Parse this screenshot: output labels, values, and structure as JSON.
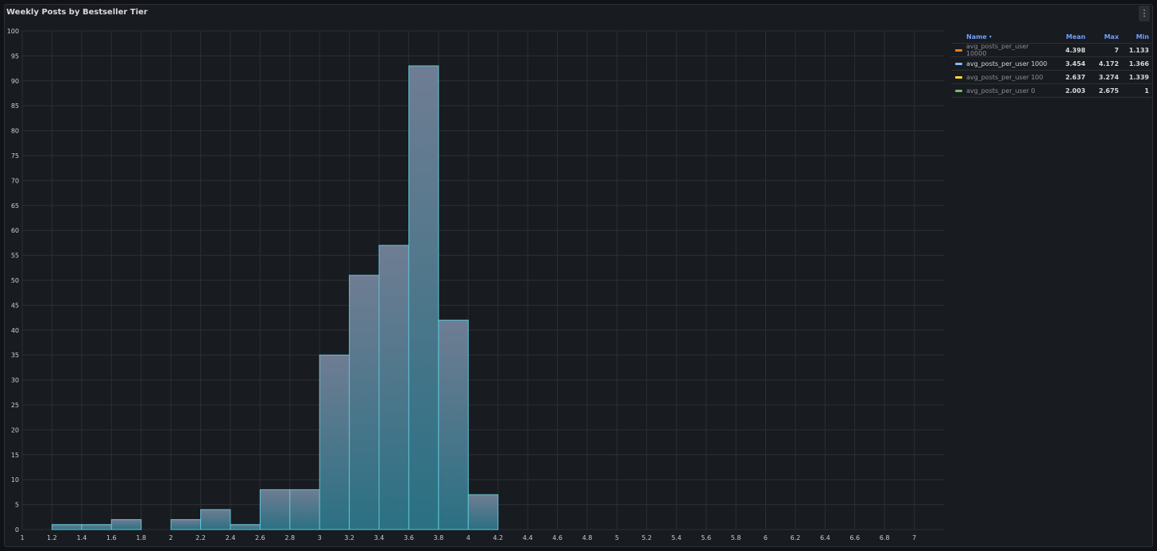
{
  "panel": {
    "title": "Weekly Posts by Bestseller Tier",
    "menu_icon": "kebab-menu-icon"
  },
  "legend": {
    "headers": {
      "name": "Name",
      "mean": "Mean",
      "max": "Max",
      "min": "Min"
    },
    "sort_indicator": "sort-desc-icon",
    "rows": [
      {
        "name": "avg_posts_per_user 10000",
        "color": "#ff780a",
        "mean": "4.398",
        "max": "7",
        "min": "1.133",
        "active": false
      },
      {
        "name": "avg_posts_per_user 1000",
        "color": "#8ab8ff",
        "mean": "3.454",
        "max": "4.172",
        "min": "1.366",
        "active": true
      },
      {
        "name": "avg_posts_per_user 100",
        "color": "#fade2a",
        "mean": "2.637",
        "max": "3.274",
        "min": "1.339",
        "active": false
      },
      {
        "name": "avg_posts_per_user 0",
        "color": "#73bf69",
        "mean": "2.003",
        "max": "2.675",
        "min": "1",
        "active": false
      }
    ]
  },
  "chart_data": {
    "type": "bar",
    "title": "Weekly Posts by Bestseller Tier",
    "xlabel": "",
    "ylabel": "",
    "xlim": [
      1,
      7.2
    ],
    "ylim": [
      0,
      100
    ],
    "x_ticks": [
      "1",
      "1.2",
      "1.4",
      "1.6",
      "1.8",
      "2",
      "2.2",
      "2.4",
      "2.6",
      "2.8",
      "3",
      "3.2",
      "3.4",
      "3.6",
      "3.8",
      "4",
      "4.2",
      "4.4",
      "4.6",
      "4.8",
      "5",
      "5.2",
      "5.4",
      "5.6",
      "5.8",
      "6",
      "6.2",
      "6.4",
      "6.6",
      "6.8",
      "7"
    ],
    "y_ticks": [
      0,
      5,
      10,
      15,
      20,
      25,
      30,
      35,
      40,
      45,
      50,
      55,
      60,
      65,
      70,
      75,
      80,
      85,
      90,
      95,
      100
    ],
    "grid": true,
    "legend_position": "right",
    "bin_width": 0.2,
    "bins": [
      {
        "start": 1.2,
        "count": 1
      },
      {
        "start": 1.4,
        "count": 1
      },
      {
        "start": 1.6,
        "count": 2
      },
      {
        "start": 2.0,
        "count": 2
      },
      {
        "start": 2.2,
        "count": 4
      },
      {
        "start": 2.4,
        "count": 1
      },
      {
        "start": 2.6,
        "count": 8
      },
      {
        "start": 2.8,
        "count": 8
      },
      {
        "start": 3.0,
        "count": 35
      },
      {
        "start": 3.2,
        "count": 51
      },
      {
        "start": 3.4,
        "count": 57
      },
      {
        "start": 3.6,
        "count": 93
      },
      {
        "start": 3.8,
        "count": 42
      },
      {
        "start": 4.0,
        "count": 7
      }
    ],
    "bar_color": "#2b7a8c",
    "bar_outline": "#5ec4d8"
  }
}
